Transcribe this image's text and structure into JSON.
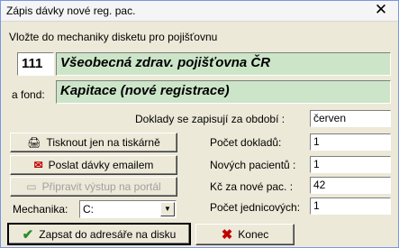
{
  "window": {
    "title": "Zápis dávky nové reg. pac.",
    "close": "✕"
  },
  "insert_label": "Vložte do mechaniky disketu pro pojišťovnu",
  "insurer": {
    "code": "111",
    "name": "Všeobecná zdrav. pojišťovna ČR"
  },
  "fund": {
    "label": "a fond:",
    "value": "Kapitace (nové registrace)"
  },
  "fields": {
    "period_label": "Doklady se zapisují za období :",
    "period_value": "červen",
    "docs_label": "Počet dokladů:",
    "docs_value": "1",
    "new_label": "Nových pacientů :",
    "new_value": "1",
    "kc_label": "Kč za nové pac. :",
    "kc_value": "42",
    "units_label": "Počet jednicových:",
    "units_value": "1"
  },
  "buttons": {
    "print": "Tisknout jen na tiskárně",
    "email": "Poslat dávky emailem",
    "portal": "Připravit výstup na portál",
    "write": "Zapsat do adresáře na disku",
    "end": "Konec"
  },
  "drive": {
    "label": "Mechanika:",
    "value": "C:"
  },
  "colors": {
    "field_green": "#cce5c8",
    "dialog_bg": "#ece9d8",
    "check_green": "#2e8b2e",
    "cross_red": "#c00000"
  }
}
